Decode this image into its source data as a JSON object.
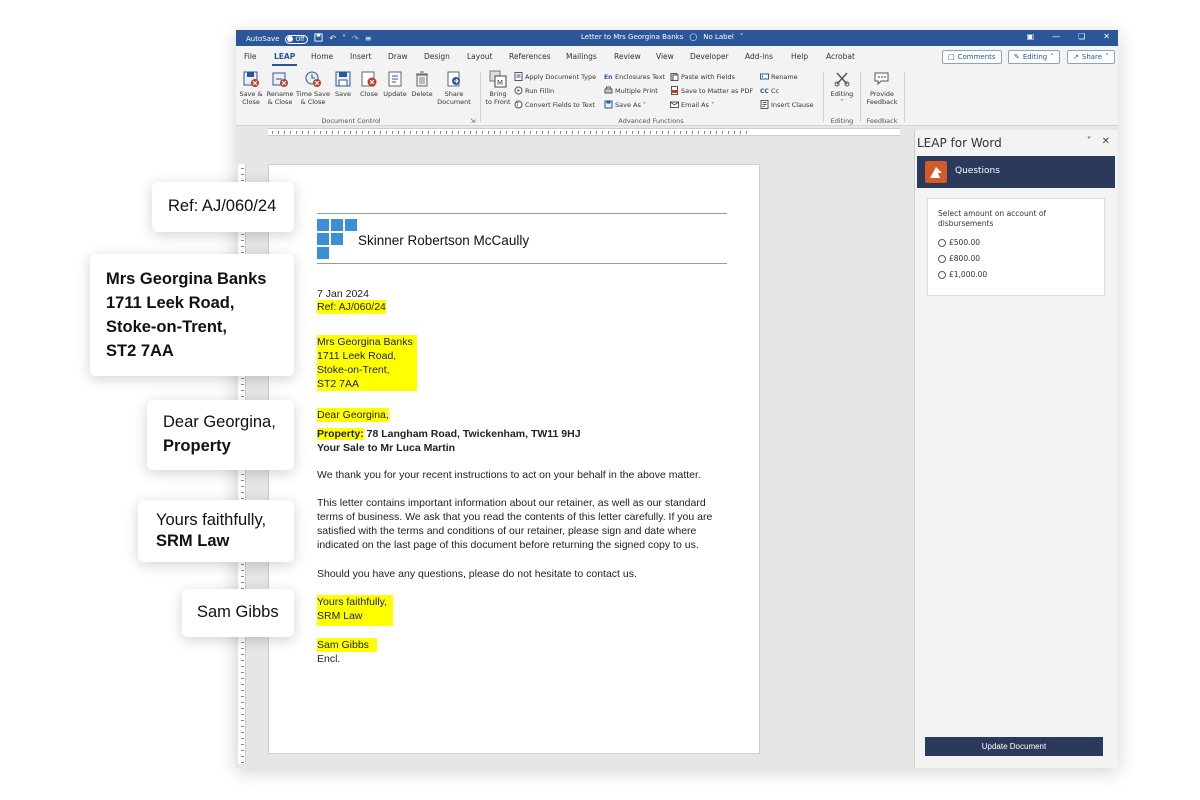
{
  "titlebar": {
    "autosave_label": "AutoSave",
    "autosave_state": "Off",
    "doc_title": "Letter to Mrs Georgina Banks",
    "sensitivity": "No Label"
  },
  "tabs": [
    "File",
    "LEAP",
    "Home",
    "Insert",
    "Draw",
    "Design",
    "Layout",
    "References",
    "Mailings",
    "Review",
    "View",
    "Developer",
    "Add-ins",
    "Help",
    "Acrobat"
  ],
  "active_tab": "LEAP",
  "tab_buttons": {
    "comments": "Comments",
    "editing": "Editing",
    "share": "Share"
  },
  "ribbon": {
    "document_control": {
      "group_label": "Document Control",
      "buttons": [
        {
          "l1": "Save &",
          "l2": "Close",
          "icon": "save-close-icon"
        },
        {
          "l1": "Rename",
          "l2": "& Close",
          "icon": "rename-close-icon"
        },
        {
          "l1": "Time Save",
          "l2": "& Close",
          "icon": "time-save-close-icon"
        },
        {
          "l1": "Save",
          "l2": "",
          "icon": "save-icon"
        },
        {
          "l1": "Close",
          "l2": "",
          "icon": "close-doc-icon"
        },
        {
          "l1": "Update",
          "l2": "",
          "icon": "update-icon"
        },
        {
          "l1": "Delete",
          "l2": "",
          "icon": "trash-icon"
        },
        {
          "l1": "Share",
          "l2": "Document",
          "icon": "share-document-icon"
        }
      ]
    },
    "advanced_functions": {
      "group_label": "Advanced Functions",
      "bring_to_front": {
        "l1": "Bring",
        "l2": "to Front"
      },
      "col1": [
        "Apply Document Type",
        "Run Fillin",
        "Convert Fields to Text"
      ],
      "col2": [
        "Enclosures Text",
        "Multiple Print",
        "Save As"
      ],
      "col3": [
        "Paste with Fields",
        "Save to Matter as PDF",
        "Email As"
      ],
      "col4": [
        "Rename",
        "Cc",
        "Insert Clause"
      ]
    },
    "editing": {
      "group_label": "Editing",
      "button": "Editing"
    },
    "feedback": {
      "group_label": "Feedback",
      "l1": "Provide",
      "l2": "Feedback"
    }
  },
  "document": {
    "company": "Skinner Robertson McCaully",
    "date": "7 Jan 2024",
    "ref": "Ref:  AJ/060/24",
    "address": [
      "Mrs Georgina Banks",
      "1711 Leek Road,",
      "Stoke-on-Trent,",
      "ST2 7AA"
    ],
    "salutation": "Dear Georgina,",
    "property_label": "Property:",
    "property_value": " 78 Langham Road, Twickenham, TW11 9HJ",
    "sale_line": "Your Sale to Mr Luca Martin",
    "para1": "We thank you for your recent instructions to act on your behalf in the above matter.",
    "para2": [
      "This letter contains important information about our retainer, as well as our standard",
      "terms of business.  We ask that you read the contents of this letter carefully.  If you are",
      "satisfied with the terms and conditions of our retainer, please sign and date where",
      "indicated on the last page of this document before returning the signed copy to us."
    ],
    "para3": "Should you have any questions, please do not hesitate to contact us.",
    "closing": [
      "Yours faithfully,",
      "SRM Law"
    ],
    "signer": "Sam Gibbs",
    "encl": "Encl."
  },
  "pane": {
    "title": "LEAP for Word",
    "section": "Questions",
    "question": "Select amount on account of disbursements",
    "options": [
      "£500.00",
      "£800.00",
      "£1,000.00"
    ],
    "update_button": "Update Document"
  },
  "callouts": {
    "ref": "Ref: AJ/060/24",
    "address": [
      "Mrs Georgina Banks",
      "1711 Leek Road,",
      "Stoke-on-Trent,",
      "ST2 7AA"
    ],
    "salutation": [
      "Dear Georgina,",
      "Property"
    ],
    "closing": [
      "Yours faithfully,",
      "SRM Law"
    ],
    "signer": "Sam Gibbs"
  },
  "colors": {
    "word_blue": "#2b579a",
    "highlight": "#ffff00",
    "leap_navy": "#2b3a5a",
    "logo_blue": "#3a8fd6",
    "leap_orange": "#d55a29"
  }
}
